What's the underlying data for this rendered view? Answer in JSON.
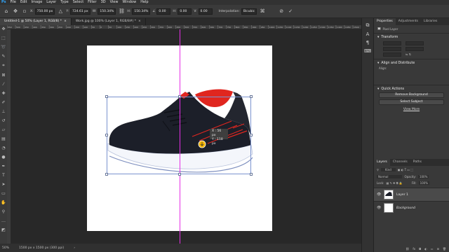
{
  "menu": [
    "File",
    "Edit",
    "Image",
    "Layer",
    "Type",
    "Select",
    "Filter",
    "3D",
    "View",
    "Window",
    "Help"
  ],
  "options": {
    "x_label": "X:",
    "x": "750.00 px",
    "y_label": "Y:",
    "y": "724.61 px",
    "w_label": "W:",
    "w": "150.34%",
    "h_label": "H:",
    "h": "150.34%",
    "angle_label": "∠",
    "angle": "0.00",
    "hskew_label": "H:",
    "hskew": "0.00",
    "vskew_label": "V:",
    "vskew": "0.00",
    "interp_label": "Interpolation:",
    "interp": "Bicubic"
  },
  "tabs": [
    {
      "label": "Untitled-1 @ 50% (Layer 1, RGB/8) *",
      "close": "×"
    },
    {
      "label": "Work.jpg @ 100% (Layer 1, RGB/8#) *",
      "close": "×"
    }
  ],
  "ruler_ticks": [
    "550",
    "500",
    "450",
    "400",
    "350",
    "300",
    "250",
    "200",
    "150",
    "100",
    "50",
    "0",
    "50",
    "100",
    "150",
    "200",
    "250",
    "300",
    "350",
    "400",
    "450",
    "500",
    "550",
    "600",
    "650",
    "700",
    "750",
    "800",
    "850",
    "900",
    "950",
    "1000",
    "1050",
    "1100",
    "1150",
    "1200",
    "1250",
    "1300",
    "1350",
    "1400",
    "1450",
    "1500"
  ],
  "measure": {
    "x": "X : 56 px",
    "y": "Y : 118 px"
  },
  "status": {
    "zoom": "50%",
    "doc": "1500 px x 1500 px (300 ppi)"
  },
  "properties": {
    "tabs": [
      "Properties",
      "Adjustments",
      "Libraries"
    ],
    "kind": "Pixel Layer",
    "transform": "Transform",
    "align": "Align and Distribute",
    "align_sub": "Align:",
    "quick": "Quick Actions",
    "remove_bg": "Remove Background",
    "select_subject": "Select Subject",
    "view_more": "View More"
  },
  "layers": {
    "tabs": [
      "Layers",
      "Channels",
      "Paths"
    ],
    "filter": "Kind",
    "blend": "Normal",
    "opacity_label": "Opacity:",
    "opacity": "100%",
    "lock_label": "Lock:",
    "fill_label": "Fill:",
    "fill": "100%",
    "items": [
      {
        "name": "Layer 1"
      },
      {
        "name": "Background"
      }
    ]
  },
  "colors": {
    "accent_guide": "#e62ee6",
    "shoe_red": "#e0261f",
    "shoe_body": "#1c1f29"
  }
}
